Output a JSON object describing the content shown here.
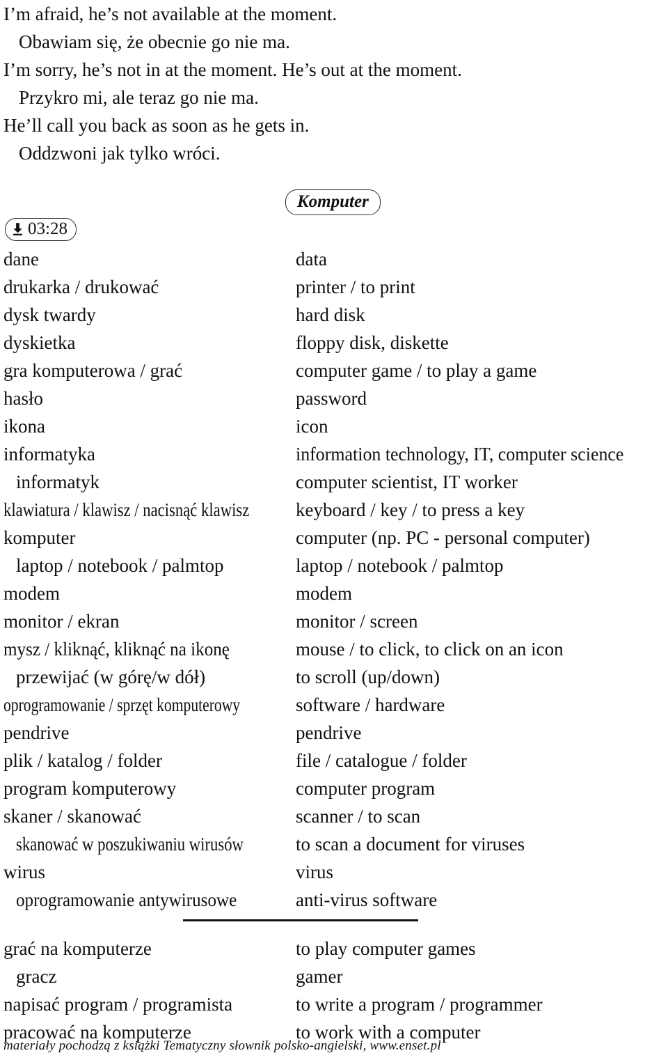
{
  "phrases": [
    {
      "text": "I’m afraid, he’s not available at the moment.",
      "indent": false
    },
    {
      "text": "Obawiam się, że obecnie go nie ma.",
      "indent": true
    },
    {
      "text": "I’m sorry, he’s not in at the moment. He’s out at the moment.",
      "indent": false
    },
    {
      "text": "Przykro mi, ale teraz go nie ma.",
      "indent": true
    },
    {
      "text": "He’ll call you back as soon as he gets in.",
      "indent": false
    },
    {
      "text": "Oddzwoni jak tylko wróci.",
      "indent": true
    }
  ],
  "header": {
    "topic_badge": "Komputer",
    "timestamp": "03:28",
    "download_icon": "download-arrow-icon"
  },
  "vocabulary": [
    {
      "pl": "dane",
      "en": "data",
      "indent": false,
      "squeeze": 0
    },
    {
      "pl": "drukarka / drukować",
      "en": "printer / to print",
      "indent": false,
      "squeeze": 0
    },
    {
      "pl": "dysk twardy",
      "en": "hard disk",
      "indent": false,
      "squeeze": 0
    },
    {
      "pl": "dyskietka",
      "en": "floppy disk, diskette",
      "indent": false,
      "squeeze": 0
    },
    {
      "pl": "gra komputerowa / grać",
      "en": "computer game / to play a game",
      "indent": false,
      "squeeze": 0
    },
    {
      "pl": "hasło",
      "en": "password",
      "indent": false,
      "squeeze": 0
    },
    {
      "pl": "ikona",
      "en": "icon",
      "indent": false,
      "squeeze": 0
    },
    {
      "pl": "informatyka",
      "en": "information technology, IT, computer science",
      "indent": false,
      "squeeze": 0,
      "en_squeeze": 1
    },
    {
      "pl": "informatyk",
      "en": "computer scientist, IT worker",
      "indent": true,
      "squeeze": 0
    },
    {
      "pl": "klawiatura / klawisz / nacisnąć klawisz",
      "en": "keyboard / key / to press a key",
      "indent": false,
      "squeeze": 2
    },
    {
      "pl": "komputer",
      "en": "computer (np. PC - personal computer)",
      "indent": false,
      "squeeze": 0
    },
    {
      "pl": "laptop / notebook / palmtop",
      "en": "laptop / notebook / palmtop",
      "indent": true,
      "squeeze": 0
    },
    {
      "pl": "modem",
      "en": "modem",
      "indent": false,
      "squeeze": 0
    },
    {
      "pl": "monitor / ekran",
      "en": "monitor / screen",
      "indent": false,
      "squeeze": 0
    },
    {
      "pl": "mysz / kliknąć, kliknąć na ikonę",
      "en": "mouse / to click, to click on an icon",
      "indent": false,
      "squeeze": 1
    },
    {
      "pl": "przewijać (w górę/w dół)",
      "en": "to scroll (up/down)",
      "indent": true,
      "squeeze": 0
    },
    {
      "pl": "oprogramowanie / sprzęt komputerowy",
      "en": "software / hardware",
      "indent": false,
      "squeeze": 3
    },
    {
      "pl": "pendrive",
      "en": "pendrive",
      "indent": false,
      "squeeze": 0
    },
    {
      "pl": "plik / katalog / folder",
      "en": "file / catalogue / folder",
      "indent": false,
      "squeeze": 0
    },
    {
      "pl": "program komputerowy",
      "en": "computer program",
      "indent": false,
      "squeeze": 0
    },
    {
      "pl": "skaner / skanować",
      "en": "scanner / to scan",
      "indent": false,
      "squeeze": 0
    },
    {
      "pl": "skanować w poszukiwaniu wirusów",
      "en": "to scan a document for viruses",
      "indent": true,
      "squeeze": 2
    },
    {
      "pl": "wirus",
      "en": "virus",
      "indent": false,
      "squeeze": 0
    },
    {
      "pl": "oprogramowanie antywirusowe",
      "en": "anti-virus software",
      "indent": true,
      "squeeze": 1
    }
  ],
  "vocabulary_phrases": [
    {
      "pl": "grać na komputerze",
      "en": "to play computer games",
      "indent": false,
      "squeeze": 0
    },
    {
      "pl": "gracz",
      "en": "gamer",
      "indent": true,
      "squeeze": 0
    },
    {
      "pl": "napisać program / programista",
      "en": "to write a program / programmer",
      "indent": false,
      "squeeze": 0
    },
    {
      "pl": "pracować na komputerze",
      "en": "to work with a computer",
      "indent": false,
      "squeeze": 0
    }
  ],
  "footer": {
    "note": "materiały pochodzą z książki Tematyczny słownik polsko-angielski, www.enset.pl"
  }
}
